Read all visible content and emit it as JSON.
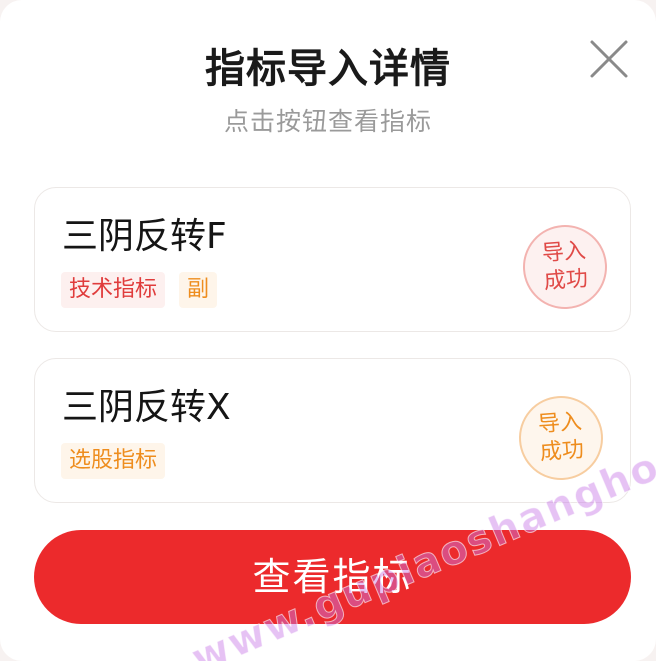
{
  "dialog": {
    "title": "指标导入详情",
    "subtitle": "点击按钮查看指标",
    "close_icon": "close-icon"
  },
  "indicators": [
    {
      "name": "三阴反转F",
      "tags": [
        {
          "label": "技术指标",
          "color": "#e03c3c"
        },
        {
          "label": "副",
          "color": "#ee8d1e"
        }
      ],
      "status": {
        "line1": "导入",
        "line2": "成功",
        "color": "#e04a47"
      }
    },
    {
      "name": "三阴反转X",
      "tags": [
        {
          "label": "选股指标",
          "color": "#ee8d1e"
        }
      ],
      "status": {
        "line1": "导入",
        "line2": "成功",
        "color": "#ee8d1e"
      }
    }
  ],
  "action": {
    "view_label": "查看指标",
    "color": "#ec2a2c"
  },
  "watermark": "www.gupiaoshanghong.com"
}
